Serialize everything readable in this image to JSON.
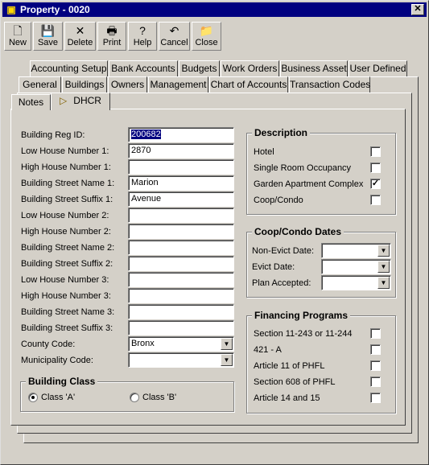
{
  "window": {
    "title": "Property - 0020",
    "close_glyph": "✕"
  },
  "toolbar": [
    {
      "key": "new",
      "label": "New",
      "icon": "new-document-icon",
      "glyph": "🗋"
    },
    {
      "key": "save",
      "label": "Save",
      "icon": "floppy-disk-icon",
      "glyph": "💾"
    },
    {
      "key": "delete",
      "label": "Delete",
      "icon": "delete-x-icon",
      "glyph": "✕"
    },
    {
      "key": "print",
      "label": "Print",
      "icon": "printer-icon",
      "glyph": "🖶"
    },
    {
      "key": "help",
      "label": "Help",
      "icon": "help-question-icon",
      "glyph": "?"
    },
    {
      "key": "cancel",
      "label": "Cancel",
      "icon": "undo-arrow-icon",
      "glyph": "↶"
    },
    {
      "key": "close",
      "label": "Close",
      "icon": "folder-icon",
      "glyph": "📁"
    }
  ],
  "tabs": {
    "row1": [
      "Accounting Setup",
      "Bank Accounts",
      "Budgets",
      "Work Orders",
      "Business Asset",
      "User Defined"
    ],
    "row2": [
      "General",
      "Buildings",
      "Owners",
      "Management",
      "Chart of Accounts",
      "Transaction Codes"
    ],
    "row3": [
      "Notes",
      "DHCR"
    ],
    "active": "DHCR"
  },
  "form": {
    "building_reg_id": {
      "label": "Building Reg ID:",
      "value": "200682"
    },
    "low_house_1": {
      "label": "Low House Number 1:",
      "value": "2870"
    },
    "high_house_1": {
      "label": "High House Number 1:",
      "value": ""
    },
    "street_name_1": {
      "label": "Building Street Name 1:",
      "value": "Marion"
    },
    "street_suffix_1": {
      "label": "Building Street Suffix 1:",
      "value": "Avenue"
    },
    "low_house_2": {
      "label": "Low House Number 2:",
      "value": ""
    },
    "high_house_2": {
      "label": "High House Number 2:",
      "value": ""
    },
    "street_name_2": {
      "label": "Building Street Name 2:",
      "value": ""
    },
    "street_suffix_2": {
      "label": "Building Street Suffix 2:",
      "value": ""
    },
    "low_house_3": {
      "label": "Low House Number 3:",
      "value": ""
    },
    "high_house_3": {
      "label": "High House Number 3:",
      "value": ""
    },
    "street_name_3": {
      "label": "Building Street Name 3:",
      "value": ""
    },
    "street_suffix_3": {
      "label": "Building Street Suffix 3:",
      "value": ""
    },
    "county_code": {
      "label": "County Code:",
      "value": "Bronx"
    },
    "municipality_code": {
      "label": "Municipality Code:",
      "value": ""
    }
  },
  "building_class": {
    "title": "Building Class",
    "options": [
      "Class 'A'",
      "Class 'B'"
    ],
    "selected": "Class 'A'"
  },
  "description": {
    "title": "Description",
    "items": [
      {
        "label": "Hotel",
        "checked": false
      },
      {
        "label": "Single Room Occupancy",
        "checked": false
      },
      {
        "label": "Garden Apartment Complex",
        "checked": true
      },
      {
        "label": "Coop/Condo",
        "checked": false
      }
    ]
  },
  "coop_dates": {
    "title": "Coop/Condo Dates",
    "fields": [
      {
        "label": "Non-Evict Date:",
        "value": ""
      },
      {
        "label": "Evict Date:",
        "value": ""
      },
      {
        "label": "Plan Accepted:",
        "value": ""
      }
    ]
  },
  "financing": {
    "title": "Financing Programs",
    "items": [
      {
        "label": "Section 11-243 or 11-244",
        "checked": false
      },
      {
        "label": "421 - A",
        "checked": false
      },
      {
        "label": "Article 11 of PHFL",
        "checked": false
      },
      {
        "label": "Section 608 of PHFL",
        "checked": false
      },
      {
        "label": "Article 14 and 15",
        "checked": false
      }
    ]
  },
  "glyphs": {
    "dropdown": "▼",
    "check": "✓",
    "tab_marker": "▷"
  }
}
